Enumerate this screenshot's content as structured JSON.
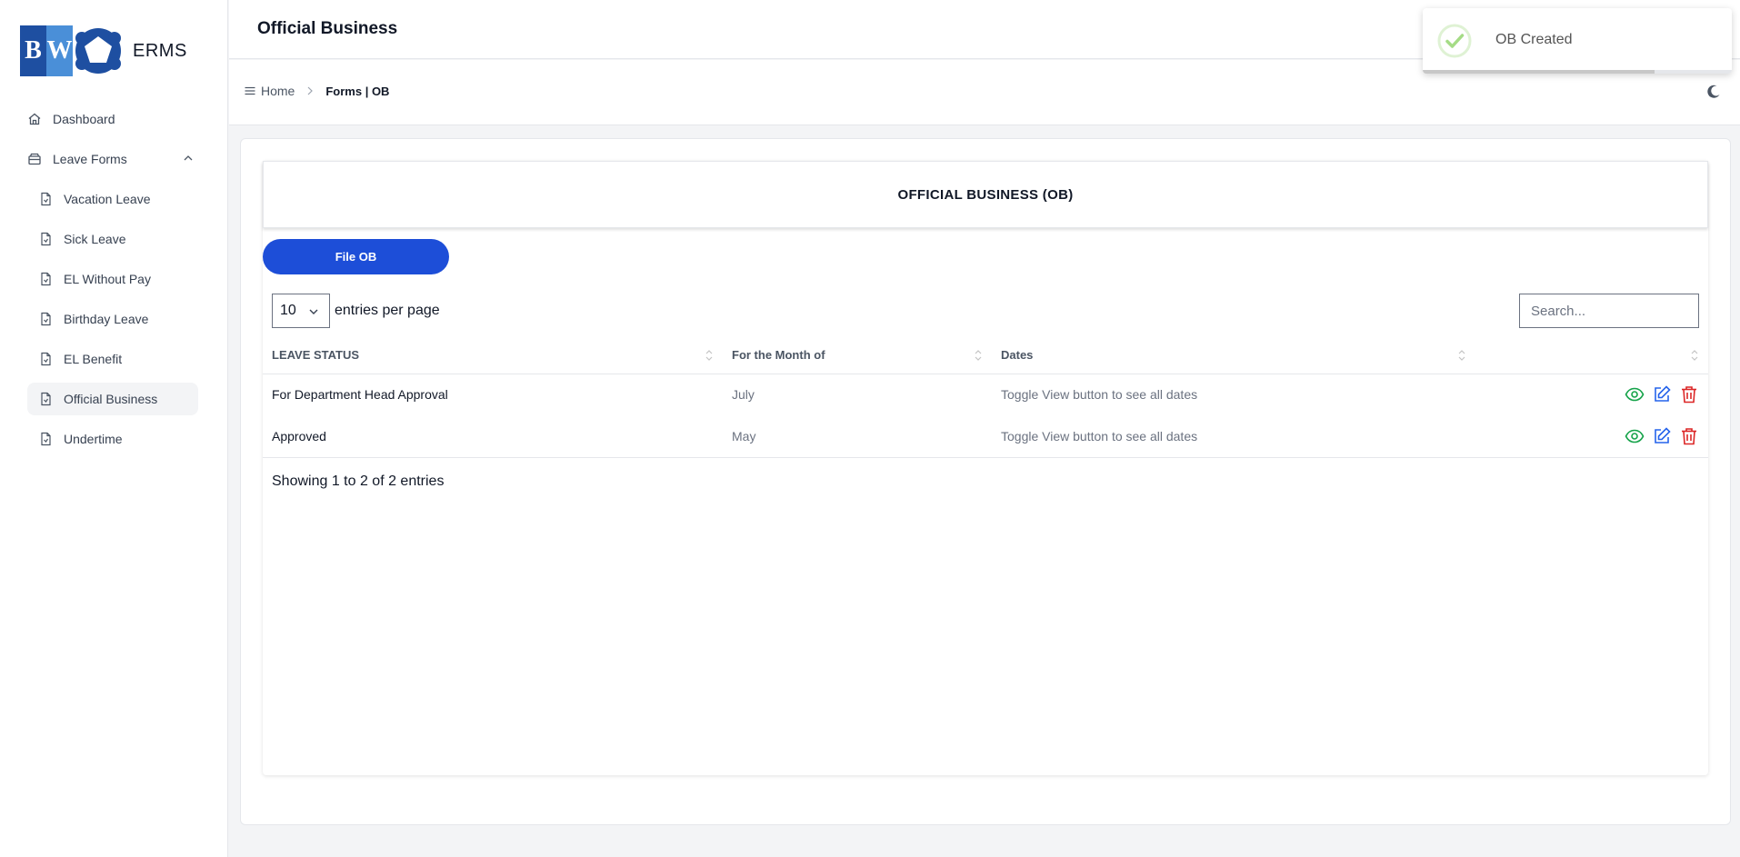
{
  "app": {
    "name": "ERMS",
    "logo_letters": [
      "B",
      "W"
    ]
  },
  "sidebar": {
    "items": [
      {
        "label": "Dashboard",
        "icon": "home-icon"
      },
      {
        "label": "Leave Forms",
        "icon": "archive-icon",
        "expanded": true
      },
      {
        "label": "Vacation Leave",
        "icon": "document-icon"
      },
      {
        "label": "Sick Leave",
        "icon": "document-icon"
      },
      {
        "label": "EL Without Pay",
        "icon": "document-icon"
      },
      {
        "label": "Birthday Leave",
        "icon": "document-icon"
      },
      {
        "label": "EL Benefit",
        "icon": "document-icon"
      },
      {
        "label": "Official Business",
        "icon": "document-icon",
        "active": true
      },
      {
        "label": "Undertime",
        "icon": "document-icon"
      }
    ]
  },
  "header": {
    "title": "Official Business"
  },
  "breadcrumb": {
    "home": "Home",
    "current": "Forms | OB"
  },
  "toast": {
    "message": "OB Created",
    "progress_pct": 75
  },
  "main": {
    "heading": "OFFICIAL BUSINESS (OB)",
    "file_button": "File OB",
    "per_page_value": "10",
    "per_page_label": "entries per page",
    "search_placeholder": "Search...",
    "columns": [
      "LEAVE STATUS",
      "For the Month of",
      "Dates",
      ""
    ],
    "rows": [
      {
        "status": "For Department Head Approval",
        "month": "July",
        "dates": "Toggle View button to see all dates"
      },
      {
        "status": "Approved",
        "month": "May",
        "dates": "Toggle View button to see all dates"
      }
    ],
    "showing": "Showing 1 to 2 of 2 entries"
  },
  "colors": {
    "primary": "#1d4ed8",
    "view": "#16a34a",
    "edit": "#2563eb",
    "delete": "#dc2626",
    "toast_check": "#a5dc86"
  }
}
